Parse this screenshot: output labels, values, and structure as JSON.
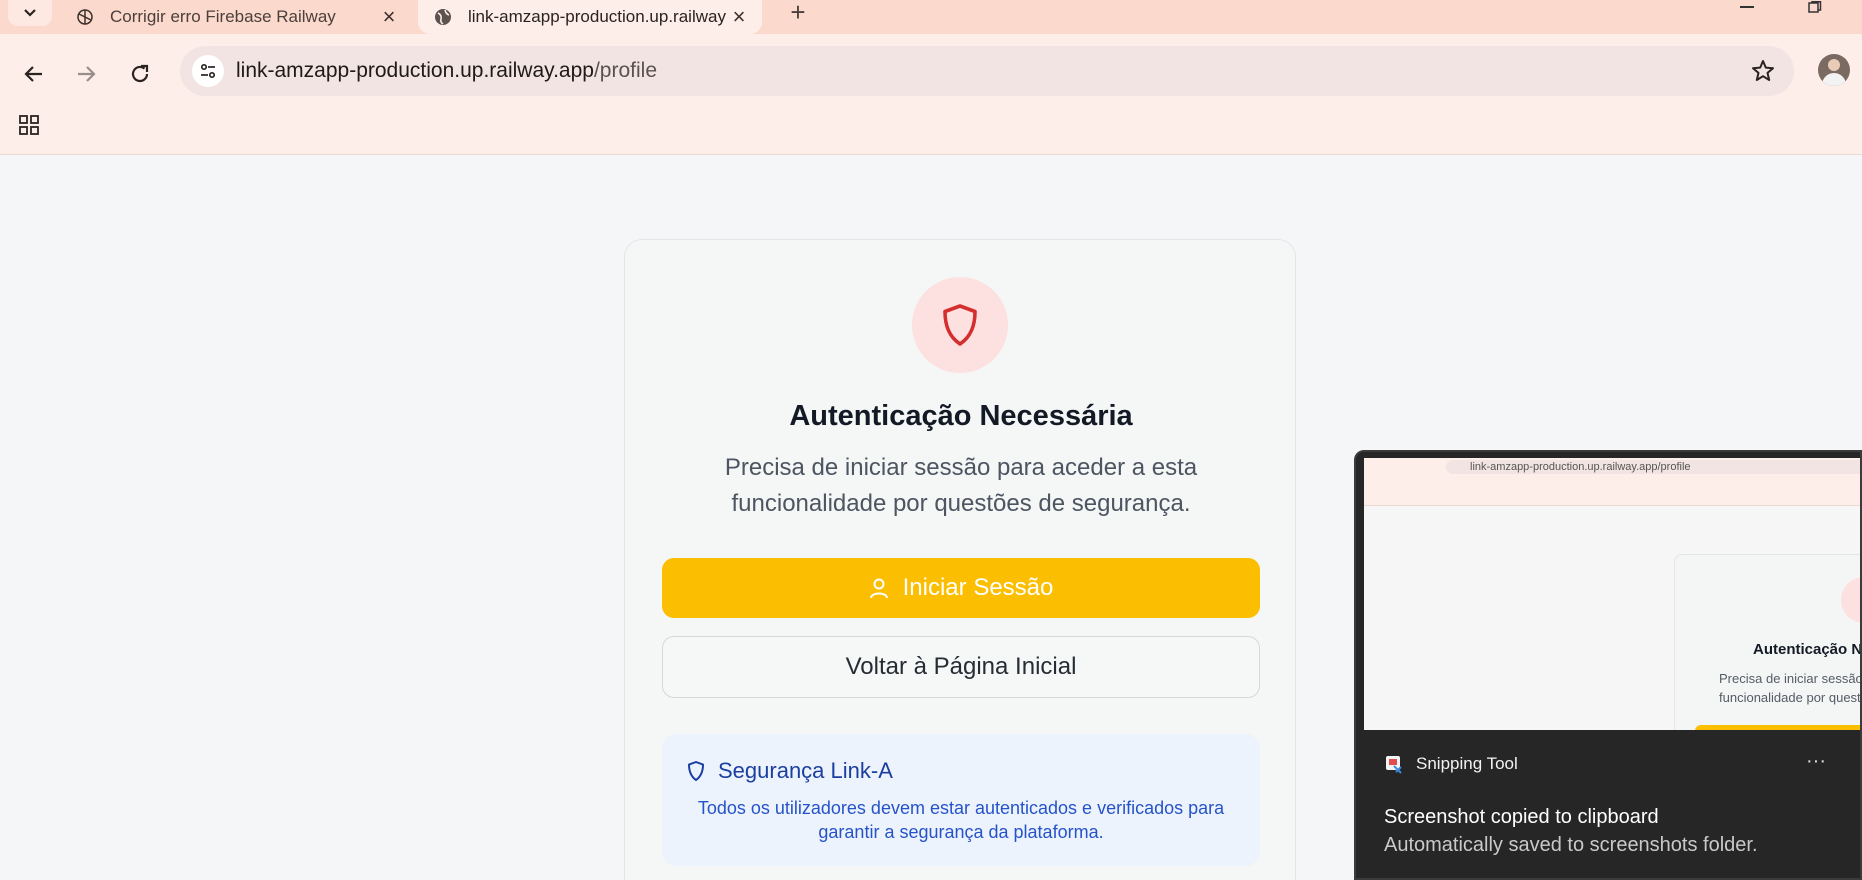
{
  "browser": {
    "tabs": [
      {
        "title": "Corrigir erro Firebase Railway",
        "active": false,
        "icon": "openai-icon"
      },
      {
        "title": "link-amzapp-production.up.railway.app/profile",
        "active": true,
        "icon": "globe-icon"
      }
    ],
    "url": {
      "host": "link-amzapp-production.up.railway.app",
      "path": "/profile"
    }
  },
  "auth_card": {
    "title": "Autenticação Necessária",
    "description": "Precisa de iniciar sessão para aceder a esta funcionalidade por questões de segurança.",
    "login_button": "Iniciar Sessão",
    "home_button": "Voltar à Página Inicial",
    "security": {
      "title": "Segurança Link-A",
      "text": "Todos os utilizadores devem estar autenticados e verificados para garantir a segurança da plataforma."
    }
  },
  "toast": {
    "app_name": "Snipping Tool",
    "more": "···",
    "heading": "Screenshot copied to clipboard",
    "body": "Automatically saved to screenshots folder.",
    "preview": {
      "url": "link-amzapp-production.up.railway.app/profile",
      "title": "Autenticação N",
      "desc_line1": "Precisa de iniciar sessão",
      "desc_line2": "funcionalidade por quest"
    }
  },
  "colors": {
    "accent_yellow": "#fcbe00",
    "shield_red": "#d32f2f",
    "info_blue": "#2553c9",
    "tab_strip": "#fcd9cd"
  }
}
